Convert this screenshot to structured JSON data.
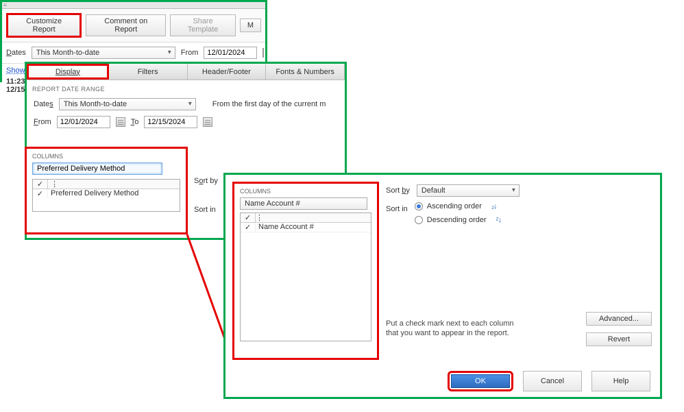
{
  "panel1": {
    "customize_btn": "Customize Report",
    "comment_btn": "Comment on Report",
    "share_btn": "Share Template",
    "more_btn_frag": "M",
    "dates_label": "Dates",
    "dates_value": "This Month-to-date",
    "from_label": "From",
    "from_value": "12/01/2024",
    "show_frag": "Show",
    "row1_time": "11:23",
    "row2_frag": "12/15"
  },
  "panel2": {
    "tabs": {
      "display": "Display",
      "filters": "Filters",
      "hf": "Header/Footer",
      "fn": "Fonts & Numbers"
    },
    "report_range_title": "REPORT DATE RANGE",
    "dates_label": "Dates",
    "dates_value": "This Month-to-date",
    "hint": "From the first day of the current m",
    "from_label": "From",
    "from_value": "12/01/2024",
    "to_label": "To",
    "to_value": "12/15/2024",
    "columns_title": "COLUMNS",
    "col_search_value": "Preferred Delivery Method",
    "col_item": "Preferred Delivery Method",
    "sortby_frag": "Sort by",
    "sortin_frag": "Sort in"
  },
  "panel3": {
    "columns_title": "COLUMNS",
    "col_search_value": "Name Account #",
    "col_item": "Name Account #",
    "sortby_label": "Sort by",
    "sortby_value": "Default",
    "sortin_label": "Sort in",
    "asc_label": "Ascending order",
    "desc_label": "Descending order",
    "hint": "Put a check mark next to each column that you want to appear in the report.",
    "advanced_btn": "Advanced...",
    "revert_btn": "Revert",
    "ok_btn": "OK",
    "cancel_btn": "Cancel",
    "help_btn": "Help"
  },
  "icons": {
    "check": "✓",
    "dots": "⋮",
    "asc": "A↓Z",
    "desc": "Z↓A"
  }
}
